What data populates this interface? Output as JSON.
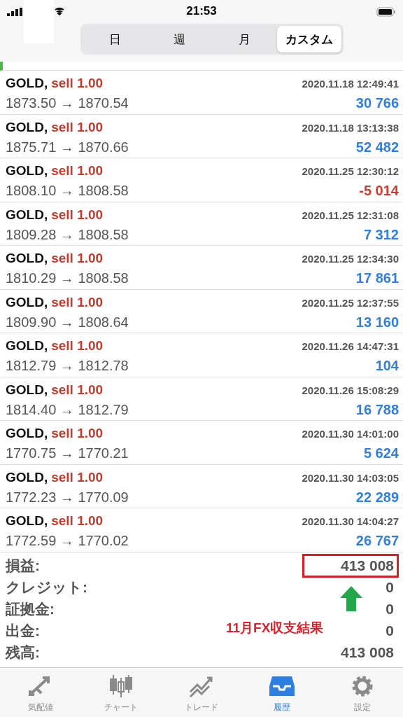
{
  "status_bar": {
    "time": "21:53"
  },
  "period_tabs": [
    {
      "label": "日",
      "selected": false
    },
    {
      "label": "週",
      "selected": false
    },
    {
      "label": "月",
      "selected": false
    },
    {
      "label": "カスタム",
      "selected": true
    }
  ],
  "deals": [
    {
      "symbol": "GOLD,",
      "type": "sell 1.00",
      "time": "2020.11.18 12:49:41",
      "prices": "1873.50 → 1870.54",
      "profit": "30 766",
      "loss": false
    },
    {
      "symbol": "GOLD,",
      "type": "sell 1.00",
      "time": "2020.11.18 13:13:38",
      "prices": "1875.71 → 1870.66",
      "profit": "52 482",
      "loss": false
    },
    {
      "symbol": "GOLD,",
      "type": "sell 1.00",
      "time": "2020.11.25 12:30:12",
      "prices": "1808.10 → 1808.58",
      "profit": "-5 014",
      "loss": true
    },
    {
      "symbol": "GOLD,",
      "type": "sell 1.00",
      "time": "2020.11.25 12:31:08",
      "prices": "1809.28 → 1808.58",
      "profit": "7 312",
      "loss": false
    },
    {
      "symbol": "GOLD,",
      "type": "sell 1.00",
      "time": "2020.11.25 12:34:30",
      "prices": "1810.29 → 1808.58",
      "profit": "17 861",
      "loss": false
    },
    {
      "symbol": "GOLD,",
      "type": "sell 1.00",
      "time": "2020.11.25 12:37:55",
      "prices": "1809.90 → 1808.64",
      "profit": "13 160",
      "loss": false
    },
    {
      "symbol": "GOLD,",
      "type": "sell 1.00",
      "time": "2020.11.26 14:47:31",
      "prices": "1812.79 → 1812.78",
      "profit": "104",
      "loss": false
    },
    {
      "symbol": "GOLD,",
      "type": "sell 1.00",
      "time": "2020.11.26 15:08:29",
      "prices": "1814.40 → 1812.79",
      "profit": "16 788",
      "loss": false
    },
    {
      "symbol": "GOLD,",
      "type": "sell 1.00",
      "time": "2020.11.30 14:01:00",
      "prices": "1770.75 → 1770.21",
      "profit": "5 624",
      "loss": false
    },
    {
      "symbol": "GOLD,",
      "type": "sell 1.00",
      "time": "2020.11.30 14:03:05",
      "prices": "1772.23 → 1770.09",
      "profit": "22 289",
      "loss": false
    },
    {
      "symbol": "GOLD,",
      "type": "sell 1.00",
      "time": "2020.11.30 14:04:27",
      "prices": "1772.59 → 1770.02",
      "profit": "26 767",
      "loss": false
    }
  ],
  "summary": [
    {
      "label": "損益:",
      "value": "413 008",
      "highlighted": true
    },
    {
      "label": "クレジット:",
      "value": "0",
      "highlighted": false
    },
    {
      "label": "証拠金:",
      "value": "0",
      "highlighted": false
    },
    {
      "label": "出金:",
      "value": "0",
      "highlighted": false
    },
    {
      "label": "残高:",
      "value": "413 008",
      "highlighted": false
    }
  ],
  "annotation": {
    "text": "11月FX収支結果"
  },
  "tab_bar": [
    {
      "label": "気配値",
      "kind": "quotes",
      "selected": false
    },
    {
      "label": "チャート",
      "kind": "chart",
      "selected": false
    },
    {
      "label": "トレード",
      "kind": "trade",
      "selected": false
    },
    {
      "label": "履歴",
      "kind": "history",
      "selected": true
    },
    {
      "label": "設定",
      "kind": "settings",
      "selected": false
    }
  ]
}
